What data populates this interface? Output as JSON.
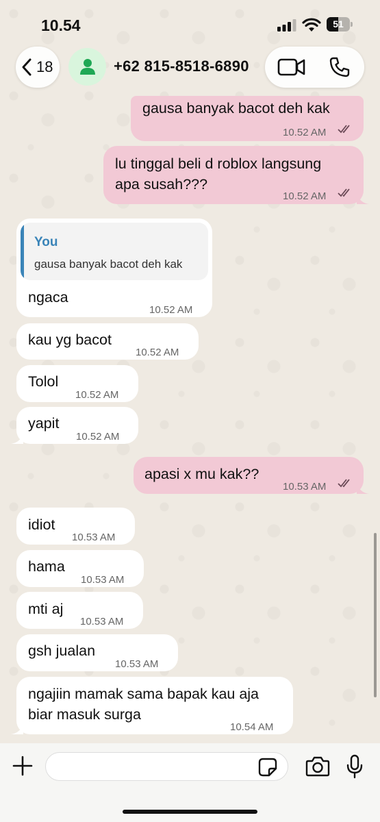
{
  "status_bar": {
    "time": "10.54",
    "battery_level": "51"
  },
  "header": {
    "unread_count": "18",
    "contact_name": "+62 815-8518-6890",
    "icons": [
      "back-chevron-icon",
      "person-icon",
      "video-call-icon",
      "phone-icon"
    ]
  },
  "messages": [
    {
      "direction": "out",
      "text": "gausa banyak bacot deh kak",
      "time": "10.52 AM",
      "status": "read"
    },
    {
      "direction": "out",
      "text_lines": [
        "lu tinggal beli d roblox langsung",
        "apa susah???"
      ],
      "time": "10.52 AM",
      "status": "read"
    },
    {
      "direction": "in",
      "reply_to": {
        "author": "You",
        "text": "gausa banyak bacot deh kak"
      },
      "text": "ngaca",
      "time": "10.52 AM"
    },
    {
      "direction": "in",
      "text": "kau yg bacot",
      "time": "10.52 AM"
    },
    {
      "direction": "in",
      "text": "Tolol",
      "time": "10.52 AM"
    },
    {
      "direction": "in",
      "text": "yapit",
      "time": "10.52 AM"
    },
    {
      "direction": "out",
      "text": "apasi x mu kak??",
      "time": "10.53 AM",
      "status": "read"
    },
    {
      "direction": "in",
      "text": "idiot",
      "time": "10.53 AM"
    },
    {
      "direction": "in",
      "text": "hama",
      "time": "10.53 AM"
    },
    {
      "direction": "in",
      "text": "mti aj",
      "time": "10.53 AM"
    },
    {
      "direction": "in",
      "text": "gsh jualan",
      "time": "10.53 AM"
    },
    {
      "direction": "in",
      "text_lines": [
        "ngajiin mamak sama bapak kau aja",
        "biar masuk surga"
      ],
      "time": "10.54 AM"
    }
  ],
  "input_bar": {
    "placeholder": "",
    "icons": [
      "plus-icon",
      "sticker-icon",
      "camera-icon",
      "microphone-icon"
    ]
  },
  "colors": {
    "background": "#efeae2",
    "outgoing_bubble": "#f2c9d5",
    "incoming_bubble": "#ffffff",
    "read_ticks": "#6b4a57",
    "quote_accent": "#3a84b8",
    "avatar_bg": "#d9f5dd",
    "avatar_icon": "#1fa855"
  }
}
